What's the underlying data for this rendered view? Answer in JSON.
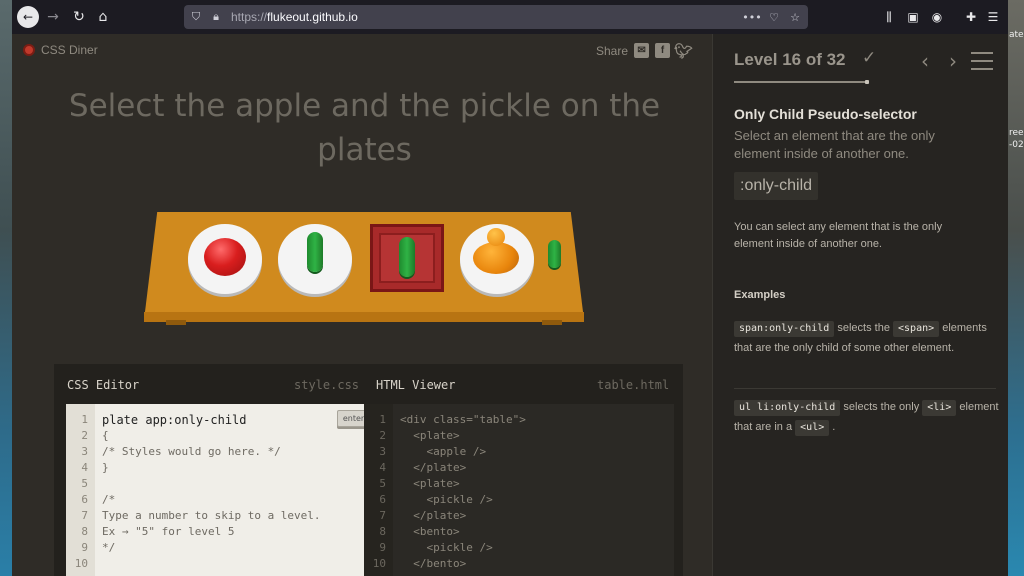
{
  "browser": {
    "url_protocol": "https://",
    "url_host": "flukeout.github.io"
  },
  "desktop": {
    "right_edge_text_1": "ate",
    "right_edge_text_2": "ree",
    "right_edge_text_3": "-02"
  },
  "game": {
    "logo_text": "CSS Diner",
    "share_label": "Share",
    "order_text": "Select the apple and the pickle on the plates"
  },
  "editor": {
    "css_title": "CSS Editor",
    "css_file": "style.css",
    "html_title": "HTML Viewer",
    "html_file": "table.html",
    "enter_label": "enter",
    "css_input": "plate app:only-child",
    "line_numbers": [
      "1",
      "2",
      "3",
      "4",
      "5",
      "6",
      "7",
      "8",
      "9",
      "10"
    ],
    "css_lines": [
      "",
      "{",
      "/* Styles would go here. */",
      "}",
      "",
      "/*",
      "Type a number to skip to a level.",
      "Ex → \"5\" for level 5",
      "*/",
      ""
    ],
    "html_lines": [
      "<div class=\"table\">",
      "  <plate>",
      "    <apple />",
      "  </plate>",
      "  <plate>",
      "    <pickle />",
      "  </plate>",
      "  <bento>",
      "    <pickle />",
      "  </bento>"
    ]
  },
  "sidebar": {
    "level_text": "Level 16 of 32",
    "selector_name": "Only Child Pseudo-selector",
    "selector_title": "Select an element that are the only element inside of another one.",
    "syntax": ":only-child",
    "hint": "You can select any element that is the only element inside of another one.",
    "examples_heading": "Examples",
    "example1_code": "span:only-child",
    "example1_text_a": " selects the ",
    "example1_tag": "<span>",
    "example1_text_b": " elements that are the only child of some other element.",
    "example2_code": "ul li:only-child",
    "example2_text_a": " selects the only ",
    "example2_tag": "<li>",
    "example2_text_b": " element that are in a ",
    "example2_tag2": "<ul>",
    "example2_text_c": " ."
  },
  "colors": {
    "accent_table": "#d08a1e",
    "apple": "#d91e1e",
    "pickle": "#2fb345",
    "orange": "#e8850c",
    "bento": "#a82a2a"
  }
}
